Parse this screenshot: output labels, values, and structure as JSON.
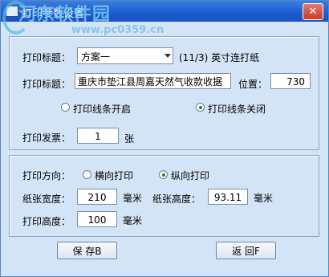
{
  "window": {
    "title": "打印参数设置",
    "watermark": "河东软件园",
    "watermark_url": "www.pc0359.cn",
    "close_label": "✕"
  },
  "form": {
    "title_label_1": "打印标题：",
    "scheme_value": "方案一",
    "scheme_info": "(11/3) 英寸连打纸",
    "title_label_2": "打印标题：",
    "title_value": "重庆市垫江县周嘉天然气收款收据",
    "position_label": "位置：",
    "position_value": "730",
    "line_on_label": "打印线条开启",
    "line_off_label": "打印线条关闭",
    "invoice_label": "打印发票：",
    "invoice_value": "1",
    "invoice_unit": "张",
    "direction_label": "打印方向：",
    "landscape_label": "横向打印",
    "portrait_label": "纵向打印",
    "width_label": "纸张宽度：",
    "width_value": "210",
    "width_unit": "毫米",
    "height_label": "纸张高度：",
    "height_value": "93.11",
    "height_unit": "毫米",
    "print_height_label": "打印高度：",
    "print_height_value": "100",
    "print_height_unit": "毫米"
  },
  "buttons": {
    "save_label": "保 存B",
    "back_label": "返 回F"
  }
}
